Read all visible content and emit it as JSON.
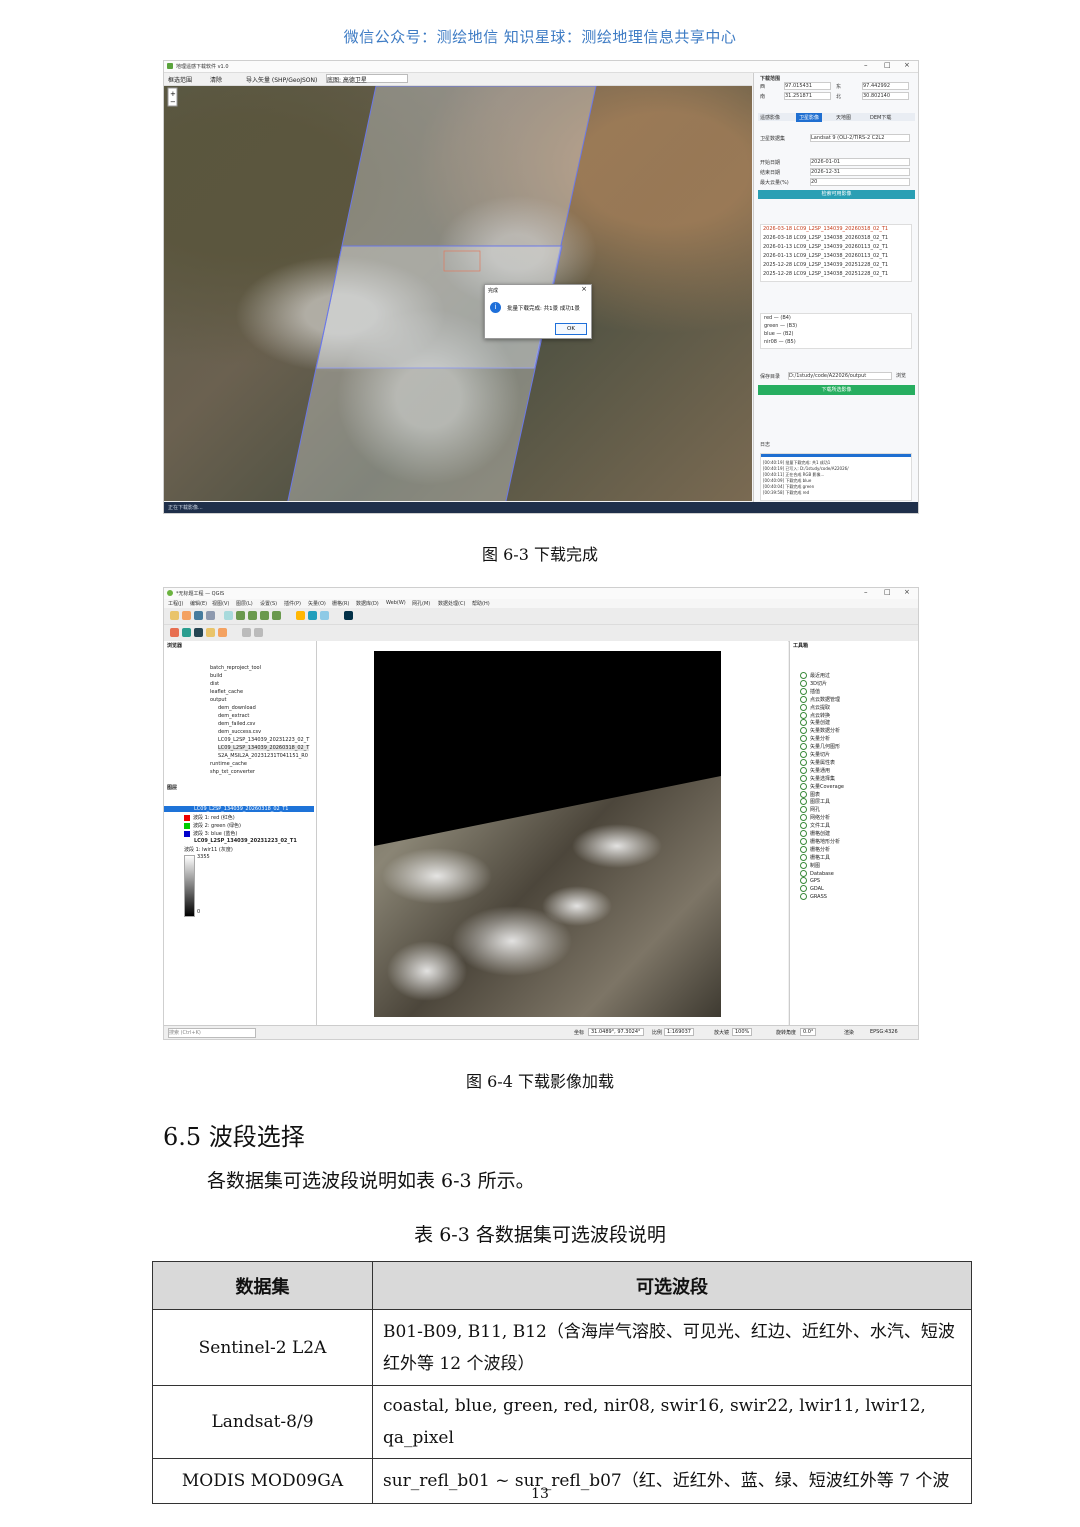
{
  "header": {
    "text": "微信公众号：测绘地信    知识星球：测绘地理信息共享中心"
  },
  "figure3": {
    "caption": "图 6-3  下载完成",
    "app_title": "地理遥感下载软件 v1.0",
    "toolbar": [
      "框选范围",
      "清除",
      "导入矢量 (SHP/GeoJSON)",
      "底图: 高德卫星"
    ],
    "panel": {
      "section_title": "下载范围",
      "west_label": "西",
      "west_value": "97.015431",
      "east_label": "东",
      "east_value": "97.442992",
      "south_label": "南",
      "south_value": "31.251871",
      "north_label": "北",
      "north_value": "30.802140",
      "tabs": [
        "遥感影像",
        "卫星影像",
        "天地图",
        "DEM下载"
      ],
      "satellite_label": "卫星数据集",
      "satellite_value": "Landsat 9 (OLI-2/TIRS-2 C2L2",
      "start_label": "开始日期",
      "start_value": "2026-01-01",
      "end_label": "结束日期",
      "end_value": "2026-12-31",
      "cloud_label": "最大云量(%)",
      "cloud_value": "20",
      "search_button": "检索可用影像",
      "results": [
        "2026-03-18  LC09_L2SP_134039_20260318_02_T1",
        "2026-03-18  LC09_L2SP_134038_20260318_02_T1",
        "2026-01-13  LC09_L2SP_134039_20260113_02_T1",
        "2026-01-13  LC09_L2SP_134038_20260113_02_T1",
        "2025-12-28  LC09_L2SP_134039_20251228_02_T1",
        "2025-12-28  LC09_L2SP_134038_20251228_02_T1"
      ],
      "bands": [
        "red — (B4)",
        "green — (B3)",
        "blue — (B2)",
        "nir08 — (B5)"
      ],
      "output_label": "保存目录",
      "output_value": "D:/1study/code/A22026/output",
      "browse_button": "浏览",
      "download_button": "下载所选影像",
      "log_title": "日志",
      "log_lines": [
        "[00:40:19] 批量下载完成: 共1 成功1",
        "[00:40:19] 已写入: D:/1study/code/A22026/",
        "[00:40:11] 正在合成 RGB 影像...",
        "[00:40:09] 下载完成 blue",
        "[00:40:04] 下载完成 green",
        "[00:39:58] 下载完成 red"
      ]
    },
    "dialog": {
      "title": "完成",
      "message": "批量下载完成: 共1景  成功1景",
      "ok": "OK"
    },
    "status": "正在下载影像..."
  },
  "figure4": {
    "caption": "图 6-4  下载影像加载",
    "app_title": "*无标题工程 — QGIS",
    "menu": [
      "工程(J)",
      "编辑(E)",
      "视图(V)",
      "图层(L)",
      "设置(S)",
      "插件(P)",
      "矢量(O)",
      "栅格(R)",
      "数据库(D)",
      "Web(W)",
      "网孔(M)",
      "数据处理(C)",
      "帮助(H)"
    ],
    "browser_title": "浏览器",
    "browser_items": [
      "batch_reproject_tool",
      "build",
      "dist",
      "leaflet_cache",
      "output",
      "dem_download",
      "dem_extract",
      "dem_failed.csv",
      "dem_success.csv",
      "LC09_L2SP_134039_20231223_02_T",
      "LC09_L2SP_134039_20260318_02_T",
      "S2A_MSIL2A_20231231T041151_R0",
      "runtime_cache",
      "shp_txt_converter"
    ],
    "layers_title": "图层",
    "layers": [
      "LC09_L2SP_134039_20260318_02_T1",
      "波段 1: red (红色)",
      "波段 2: green (绿色)",
      "波段 3: blue (蓝色)",
      "LC09_L2SP_134039_20231223_02_T1",
      "波段 1: lwir11 (灰度)",
      "3355",
      "0"
    ],
    "toolbox_title": "工具箱",
    "toolbox_items": [
      "最近用过",
      "3D切片",
      "插值",
      "点云数据管理",
      "点云提取",
      "点云转换",
      "矢量创建",
      "矢量数据分析",
      "矢量分析",
      "矢量几何图形",
      "矢量切片",
      "矢量属性表",
      "矢量通用",
      "矢量选择集",
      "矢量Coverage",
      "图表",
      "图层工具",
      "网孔",
      "网络分析",
      "文件工具",
      "栅格创建",
      "栅格地形分析",
      "栅格分析",
      "栅格工具",
      "制图",
      "Database",
      "GPS",
      "GDAL",
      "GRASS"
    ],
    "search_placeholder": "搜索 (Ctrl+K)",
    "status": {
      "coord_label": "坐标",
      "coord_value": "31.0489°, 97.3024°",
      "scale_label": "比例",
      "scale_value": "1:169037",
      "magnifier_label": "放大镜",
      "magnifier_value": "100%",
      "rotation_label": "旋转角度",
      "rotation_value": "0.0°",
      "render_label": "渲染",
      "crs": "EPSG:4326"
    }
  },
  "section": {
    "title": "6.5 波段选择",
    "paragraph": "各数据集可选波段说明如表 6-3 所示。"
  },
  "table": {
    "caption": "表 6-3  各数据集可选波段说明",
    "headers": [
      "数据集",
      "可选波段"
    ],
    "rows": [
      [
        "Sentinel-2 L2A",
        "B01-B09, B11, B12（含海岸气溶胶、可见光、红边、近红外、水汽、短波红外等 12 个波段）"
      ],
      [
        "Landsat-8/9",
        "coastal, blue, green, red, nir08, swir16, swir22, lwir11, lwir12, qa_pixel"
      ],
      [
        "MODIS MOD09GA",
        "sur_refl_b01 ~ sur_refl_b07（红、近红外、蓝、绿、短波红外等 7 个波"
      ]
    ]
  },
  "page_number": "13"
}
